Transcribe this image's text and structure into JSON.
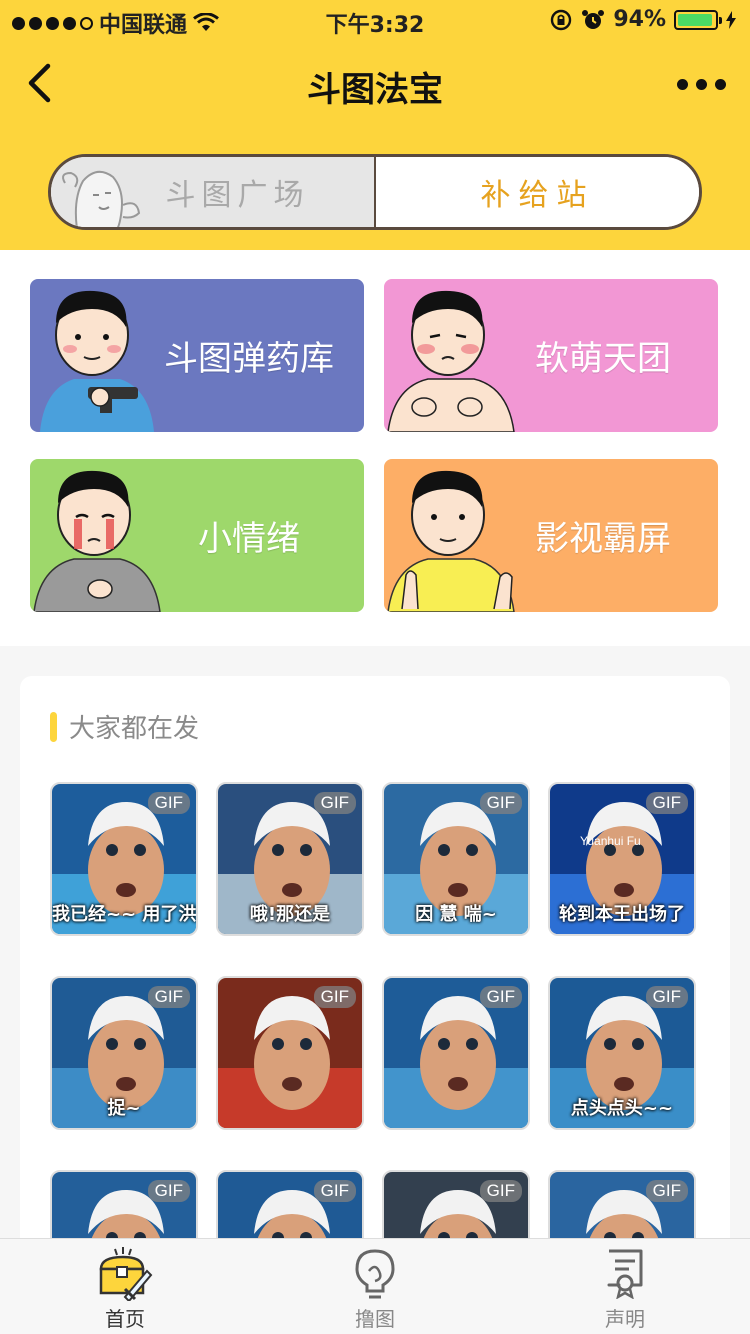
{
  "status_bar": {
    "carrier": "中国联通",
    "time": "下午3:32",
    "battery_percent": "94%",
    "battery_level": 0.94
  },
  "nav": {
    "title": "斗图法宝"
  },
  "segment": {
    "left_label": "斗图广场",
    "right_label": "补给站",
    "active": "right"
  },
  "categories": [
    {
      "label": "斗图弹药库",
      "color": "#6b78c0"
    },
    {
      "label": "软萌天团",
      "color": "#f297d4"
    },
    {
      "label": "小情绪",
      "color": "#9ed86b"
    },
    {
      "label": "影视霸屏",
      "color": "#fdae66"
    }
  ],
  "popular": {
    "title": "大家都在发",
    "badge": "GIF",
    "items": [
      {
        "caption": "我已经~~ 用了洪荒之力啦!"
      },
      {
        "caption": "哦!那还是"
      },
      {
        "caption": "因 慧 喘~"
      },
      {
        "caption": "轮到本王出场了",
        "overlay": "Yuanhui Fu"
      },
      {
        "caption": "捉~"
      },
      {
        "caption": ""
      },
      {
        "caption": ""
      },
      {
        "caption": "点头点头~~"
      },
      {
        "caption": ""
      },
      {
        "caption": ""
      },
      {
        "caption": ""
      },
      {
        "caption": ""
      }
    ]
  },
  "tabbar": {
    "home": "首页",
    "make": "撸图",
    "statement": "声明"
  },
  "colors": {
    "accent": "#fdd53c",
    "segment_active_text": "#e6a21f"
  }
}
